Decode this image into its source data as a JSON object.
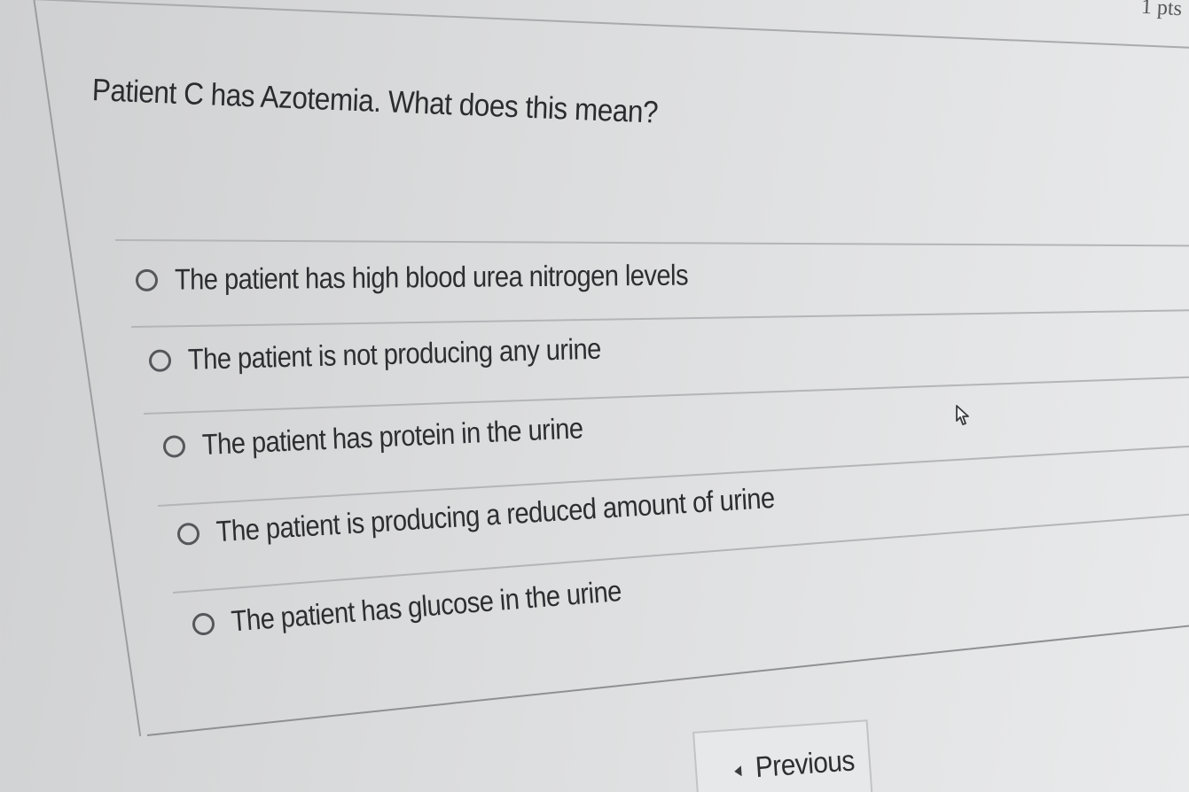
{
  "quiz": {
    "points_label": "1 pts",
    "question_text": "Patient C has Azotemia. What does this mean?",
    "answers": [
      {
        "label": "The patient has high blood urea nitrogen levels"
      },
      {
        "label": "The patient is not producing any urine"
      },
      {
        "label": "The patient has protein in the urine"
      },
      {
        "label": "The patient is producing a reduced amount of urine"
      },
      {
        "label": "The patient has glucose in the urine"
      }
    ]
  },
  "navigation": {
    "previous_label": "Previous",
    "previous_icon": "caret-left-icon"
  },
  "pointer": {
    "icon": "hand-cursor-icon"
  }
}
